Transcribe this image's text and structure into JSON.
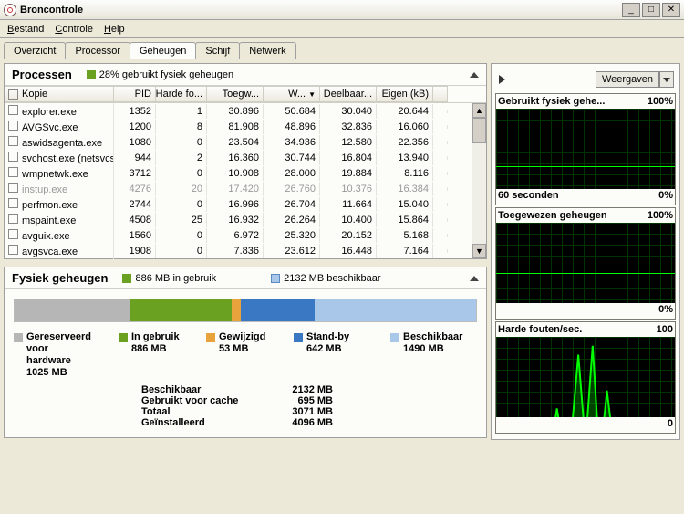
{
  "window": {
    "title": "Broncontrole"
  },
  "menu": {
    "bestand": "Bestand",
    "controle": "Controle",
    "help": "Help"
  },
  "tabs": {
    "overzicht": "Overzicht",
    "processor": "Processor",
    "geheugen": "Geheugen",
    "schijf": "Schijf",
    "netwerk": "Netwerk"
  },
  "processes": {
    "title": "Processen",
    "summary": "28% gebruikt fysiek geheugen",
    "cols": {
      "kopie": "Kopie",
      "pid": "PID",
      "hf": "Harde fo...",
      "toeg": "Toegw...",
      "w": "W...",
      "deel": "Deelbaar...",
      "eigen": "Eigen (kB)"
    },
    "rows": [
      {
        "name": "explorer.exe",
        "pid": "1352",
        "hf": "1",
        "toeg": "30.896",
        "w": "50.684",
        "deel": "30.040",
        "eigen": "20.644"
      },
      {
        "name": "AVGSvc.exe",
        "pid": "1200",
        "hf": "8",
        "toeg": "81.908",
        "w": "48.896",
        "deel": "32.836",
        "eigen": "16.060"
      },
      {
        "name": "aswidsagenta.exe",
        "pid": "1080",
        "hf": "0",
        "toeg": "23.504",
        "w": "34.936",
        "deel": "12.580",
        "eigen": "22.356"
      },
      {
        "name": "svchost.exe (netsvcs)",
        "pid": "944",
        "hf": "2",
        "toeg": "16.360",
        "w": "30.744",
        "deel": "16.804",
        "eigen": "13.940"
      },
      {
        "name": "wmpnetwk.exe",
        "pid": "3712",
        "hf": "0",
        "toeg": "10.908",
        "w": "28.000",
        "deel": "19.884",
        "eigen": "8.116"
      },
      {
        "name": "instup.exe",
        "pid": "4276",
        "hf": "20",
        "toeg": "17.420",
        "w": "26.760",
        "deel": "10.376",
        "eigen": "16.384",
        "disabled": true
      },
      {
        "name": "perfmon.exe",
        "pid": "2744",
        "hf": "0",
        "toeg": "16.996",
        "w": "26.704",
        "deel": "11.664",
        "eigen": "15.040"
      },
      {
        "name": "mspaint.exe",
        "pid": "4508",
        "hf": "25",
        "toeg": "16.932",
        "w": "26.264",
        "deel": "10.400",
        "eigen": "15.864"
      },
      {
        "name": "avguix.exe",
        "pid": "1560",
        "hf": "0",
        "toeg": "6.972",
        "w": "25.320",
        "deel": "20.152",
        "eigen": "5.168"
      },
      {
        "name": "avgsvca.exe",
        "pid": "1908",
        "hf": "0",
        "toeg": "7.836",
        "w": "23.612",
        "deel": "16.448",
        "eigen": "7.164"
      }
    ]
  },
  "memory": {
    "title": "Fysiek geheugen",
    "in_use": "886 MB in gebruik",
    "available": "2132 MB beschikbaar",
    "legend": {
      "reserved": {
        "label": "Gereserveerd\nvoor\nhardware",
        "val": "1025 MB",
        "color": "#b6b6b6"
      },
      "inuse": {
        "label": "In gebruik",
        "val": "886 MB",
        "color": "#6aa121"
      },
      "modified": {
        "label": "Gewijzigd",
        "val": "53 MB",
        "color": "#e8a33d"
      },
      "standby": {
        "label": "Stand-by",
        "val": "642 MB",
        "color": "#3a78c3"
      },
      "free": {
        "label": "Beschikbaar",
        "val": "1490 MB",
        "color": "#a9c7e8"
      }
    },
    "stats": {
      "avail": {
        "label": "Beschikbaar",
        "val": "2132 MB"
      },
      "cache": {
        "label": "Gebruikt voor cache",
        "val": "695 MB"
      },
      "total": {
        "label": "Totaal",
        "val": "3071 MB"
      },
      "installed": {
        "label": "Geïnstalleerd",
        "val": "4096 MB"
      }
    }
  },
  "right": {
    "views": "Weergaven",
    "g1": {
      "title": "Gebruikt fysiek gehe...",
      "max": "100%",
      "footer_l": "60 seconden",
      "footer_r": "0%"
    },
    "g2": {
      "title": "Toegewezen geheugen",
      "max": "100%",
      "footer_r": "0%"
    },
    "g3": {
      "title": "Harde fouten/sec.",
      "max": "100",
      "footer_r": "0"
    }
  }
}
